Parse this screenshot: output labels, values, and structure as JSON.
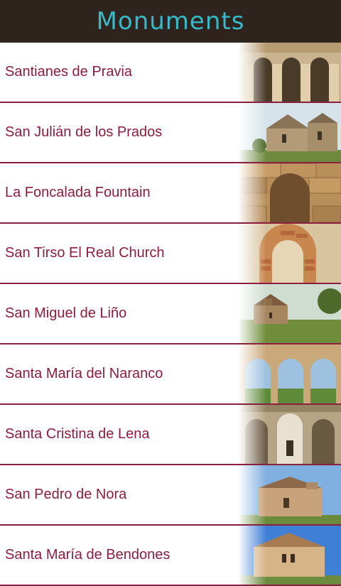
{
  "header": {
    "title": "Monuments"
  },
  "monuments": [
    {
      "name": "Santianes de Pravia",
      "thumb": "arches-stone-icon"
    },
    {
      "name": "San Julián de los Prados",
      "thumb": "church-exterior-icon"
    },
    {
      "name": "La Foncalada Fountain",
      "thumb": "fountain-stone-icon"
    },
    {
      "name": "San Tirso El Real Church",
      "thumb": "brick-arch-icon"
    },
    {
      "name": "San Miguel de Liño",
      "thumb": "church-hill-icon"
    },
    {
      "name": "Santa María del Naranco",
      "thumb": "arcade-view-icon"
    },
    {
      "name": "Santa Cristina de Lena",
      "thumb": "church-interior-icon"
    },
    {
      "name": "San Pedro de Nora",
      "thumb": "church-sky-icon"
    },
    {
      "name": "Santa María de Bendones",
      "thumb": "church-blue-sky-icon"
    }
  ],
  "colors": {
    "header_bg": "#2e231d",
    "title": "#37b9c7",
    "label": "#8b1d3f",
    "divider": "#8a1f3f"
  }
}
